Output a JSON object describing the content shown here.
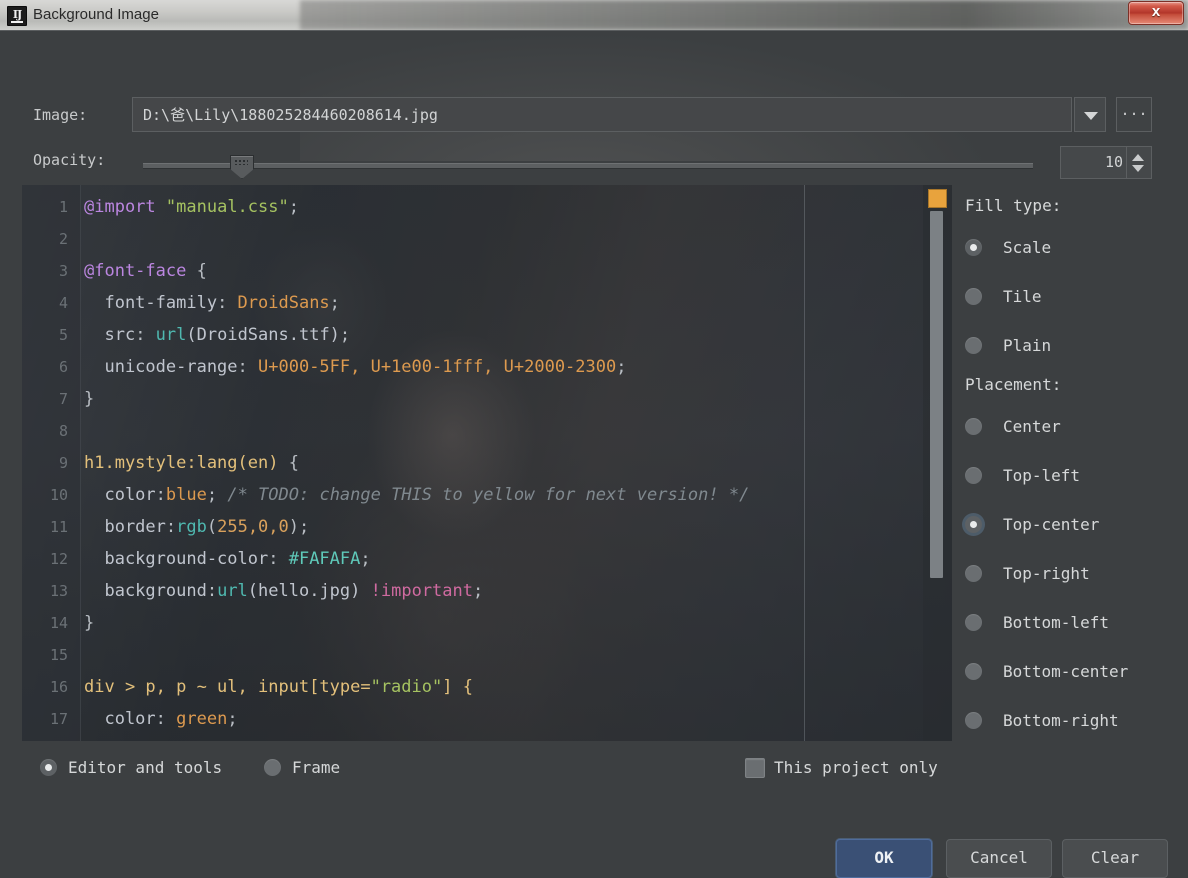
{
  "window": {
    "title": "Background Image",
    "app_icon": "intellij-idea-icon",
    "close_label": "x"
  },
  "form": {
    "image_label": "Image:",
    "image_path": "D:\\爸\\Lily\\188025284460208614.jpg",
    "dropdown_icon": "chevron-down-icon",
    "browse_label": "...",
    "opacity_label": "Opacity:",
    "opacity_value": "10",
    "opacity_percent": 10
  },
  "editor_preview": {
    "lines": [
      {
        "n": "1",
        "tokens": [
          {
            "t": "@import",
            "c": "t-at"
          },
          {
            "t": " ",
            "c": ""
          },
          {
            "t": "\"manual.css\"",
            "c": "t-str"
          },
          {
            "t": ";",
            "c": "t-punct"
          }
        ]
      },
      {
        "n": "2",
        "tokens": []
      },
      {
        "n": "3",
        "tokens": [
          {
            "t": "@font-face",
            "c": "t-at"
          },
          {
            "t": " {",
            "c": "t-punct"
          }
        ]
      },
      {
        "n": "4",
        "tokens": [
          {
            "t": "  font-family",
            "c": "t-prop"
          },
          {
            "t": ": ",
            "c": "t-punct"
          },
          {
            "t": "DroidSans",
            "c": "t-val"
          },
          {
            "t": ";",
            "c": "t-punct"
          }
        ]
      },
      {
        "n": "5",
        "tokens": [
          {
            "t": "  src",
            "c": "t-prop"
          },
          {
            "t": ": ",
            "c": "t-punct"
          },
          {
            "t": "url",
            "c": "t-fn"
          },
          {
            "t": "(DroidSans.ttf)",
            "c": "t-prop"
          },
          {
            "t": ";",
            "c": "t-punct"
          }
        ]
      },
      {
        "n": "6",
        "tokens": [
          {
            "t": "  unicode-range",
            "c": "t-prop"
          },
          {
            "t": ": ",
            "c": "t-punct"
          },
          {
            "t": "U+000-5FF, U+1e00-1fff, U+2000-2300",
            "c": "t-val"
          },
          {
            "t": ";",
            "c": "t-punct"
          }
        ]
      },
      {
        "n": "7",
        "tokens": [
          {
            "t": "}",
            "c": "t-punct"
          }
        ]
      },
      {
        "n": "8",
        "tokens": []
      },
      {
        "n": "9",
        "tokens": [
          {
            "t": "h1.mystyle:lang(en)",
            "c": "t-sel"
          },
          {
            "t": " {",
            "c": "t-punct"
          }
        ]
      },
      {
        "n": "10",
        "tokens": [
          {
            "t": "  color",
            "c": "t-prop"
          },
          {
            "t": ":",
            "c": "t-punct"
          },
          {
            "t": "blue",
            "c": "t-blue"
          },
          {
            "t": ";",
            "c": "t-punct"
          },
          {
            "t": " /* TODO: change THIS to yellow for next version! */",
            "c": "t-cmt"
          }
        ]
      },
      {
        "n": "11",
        "tokens": [
          {
            "t": "  border",
            "c": "t-prop"
          },
          {
            "t": ":",
            "c": "t-punct"
          },
          {
            "t": "rgb",
            "c": "t-fn"
          },
          {
            "t": "(",
            "c": "t-punct"
          },
          {
            "t": "255,0,0",
            "c": "t-num"
          },
          {
            "t": ");",
            "c": "t-punct"
          }
        ]
      },
      {
        "n": "12",
        "tokens": [
          {
            "t": "  background-color",
            "c": "t-prop"
          },
          {
            "t": ": ",
            "c": "t-punct"
          },
          {
            "t": "#FAFAFA",
            "c": "t-hash"
          },
          {
            "t": ";",
            "c": "t-punct"
          }
        ]
      },
      {
        "n": "13",
        "tokens": [
          {
            "t": "  background",
            "c": "t-prop"
          },
          {
            "t": ":",
            "c": "t-punct"
          },
          {
            "t": "url",
            "c": "t-fn"
          },
          {
            "t": "(hello.jpg)",
            "c": "t-prop"
          },
          {
            "t": " ",
            "c": ""
          },
          {
            "t": "!important",
            "c": "t-imp"
          },
          {
            "t": ";",
            "c": "t-punct"
          }
        ]
      },
      {
        "n": "14",
        "tokens": [
          {
            "t": "}",
            "c": "t-punct"
          }
        ]
      },
      {
        "n": "15",
        "tokens": []
      },
      {
        "n": "16",
        "tokens": [
          {
            "t": "div > p, p ~ ul, input[type=",
            "c": "t-sel"
          },
          {
            "t": "\"radio\"",
            "c": "t-str"
          },
          {
            "t": "] {",
            "c": "t-sel"
          }
        ]
      },
      {
        "n": "17",
        "tokens": [
          {
            "t": "  color",
            "c": "t-prop"
          },
          {
            "t": ": ",
            "c": "t-punct"
          },
          {
            "t": "green",
            "c": "t-val"
          },
          {
            "t": ";",
            "c": "t-punct"
          }
        ]
      }
    ],
    "warning_marker": "warning-marker-icon"
  },
  "fill_type": {
    "label": "Fill type:",
    "options": [
      {
        "label": "Scale",
        "selected": true,
        "focused": false
      },
      {
        "label": "Tile",
        "selected": false,
        "focused": false
      },
      {
        "label": "Plain",
        "selected": false,
        "focused": false
      }
    ]
  },
  "placement": {
    "label": "Placement:",
    "options": [
      {
        "label": "Center",
        "selected": false,
        "focused": false
      },
      {
        "label": "Top-left",
        "selected": false,
        "focused": false
      },
      {
        "label": "Top-center",
        "selected": true,
        "focused": true
      },
      {
        "label": "Top-right",
        "selected": false,
        "focused": false
      },
      {
        "label": "Bottom-left",
        "selected": false,
        "focused": false
      },
      {
        "label": "Bottom-center",
        "selected": false,
        "focused": false
      },
      {
        "label": "Bottom-right",
        "selected": false,
        "focused": false
      }
    ]
  },
  "scope": {
    "options": [
      {
        "label": "Editor and tools",
        "selected": true
      },
      {
        "label": "Frame",
        "selected": false
      }
    ],
    "project_only_label": "This project only",
    "project_only_checked": false
  },
  "buttons": {
    "ok": "OK",
    "cancel": "Cancel",
    "clear": "Clear"
  },
  "colors": {
    "dialog_bg": "#3c3f41",
    "field_bg": "#45484a",
    "text": "#d2d4d5",
    "ok_accent": "#3a5075",
    "warning_marker": "#e8a33d",
    "close_button": "#b2352a"
  }
}
